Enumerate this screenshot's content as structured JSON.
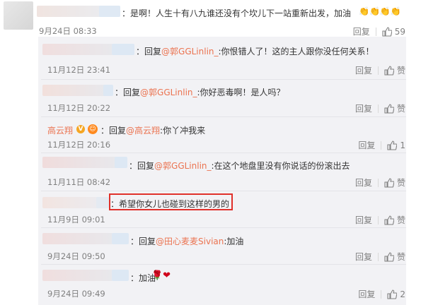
{
  "colors": {
    "link": "#eb7350",
    "highlight": "#e0302a",
    "reply_bg": "#f2f2f5"
  },
  "top_comment": {
    "text": "：是啊！人生十有八九谁还没有个坎儿下一站重新出发，加油",
    "emoji": "👏👏👏👏",
    "date": "9月24日 08:33",
    "reply_label": "回复",
    "like_count": "59"
  },
  "replies": [
    {
      "prefix": "：回复",
      "mention": "@郭GGLinlin_",
      "body": ":你恨错人了！这的主人跟你没任何关系！",
      "date": "11月12日 23:41",
      "reply_label": "回复",
      "like_label": "赞"
    },
    {
      "prefix": "：回复",
      "mention": "@郭GGLinlin_",
      "body": ":你好恶毒啊！是人吗？",
      "date": "11月12日 20:22",
      "reply_label": "回复",
      "like_label": "赞"
    },
    {
      "username": "高云翔",
      "prefix": "：回复",
      "mention": "@高云翔",
      "body": ":你丫冲我来",
      "date": "11月12日 20:16",
      "reply_label": "回复",
      "like_label": "1"
    },
    {
      "prefix": "：回复",
      "mention": "@郭GGLinlin_",
      "body": ":在这个地盘里没有你说话的份滚出去",
      "date": "11月11日 08:42",
      "reply_label": "回复",
      "like_label": "赞"
    },
    {
      "prefix": "：",
      "body": "希望你女儿也碰到这样的男的",
      "date": "11月9日 09:01",
      "reply_label": "回复",
      "like_label": "赞"
    },
    {
      "prefix": "：回复",
      "mention": "@田心麦麦Sivian",
      "body": ":加油",
      "date": "9月24日 09:50",
      "reply_label": "回复",
      "like_label": "赞"
    },
    {
      "prefix": "：加油",
      "emoji": "🌹❤",
      "date": "9月24日 09:49",
      "reply_label": "回复",
      "like_label": "2"
    }
  ]
}
